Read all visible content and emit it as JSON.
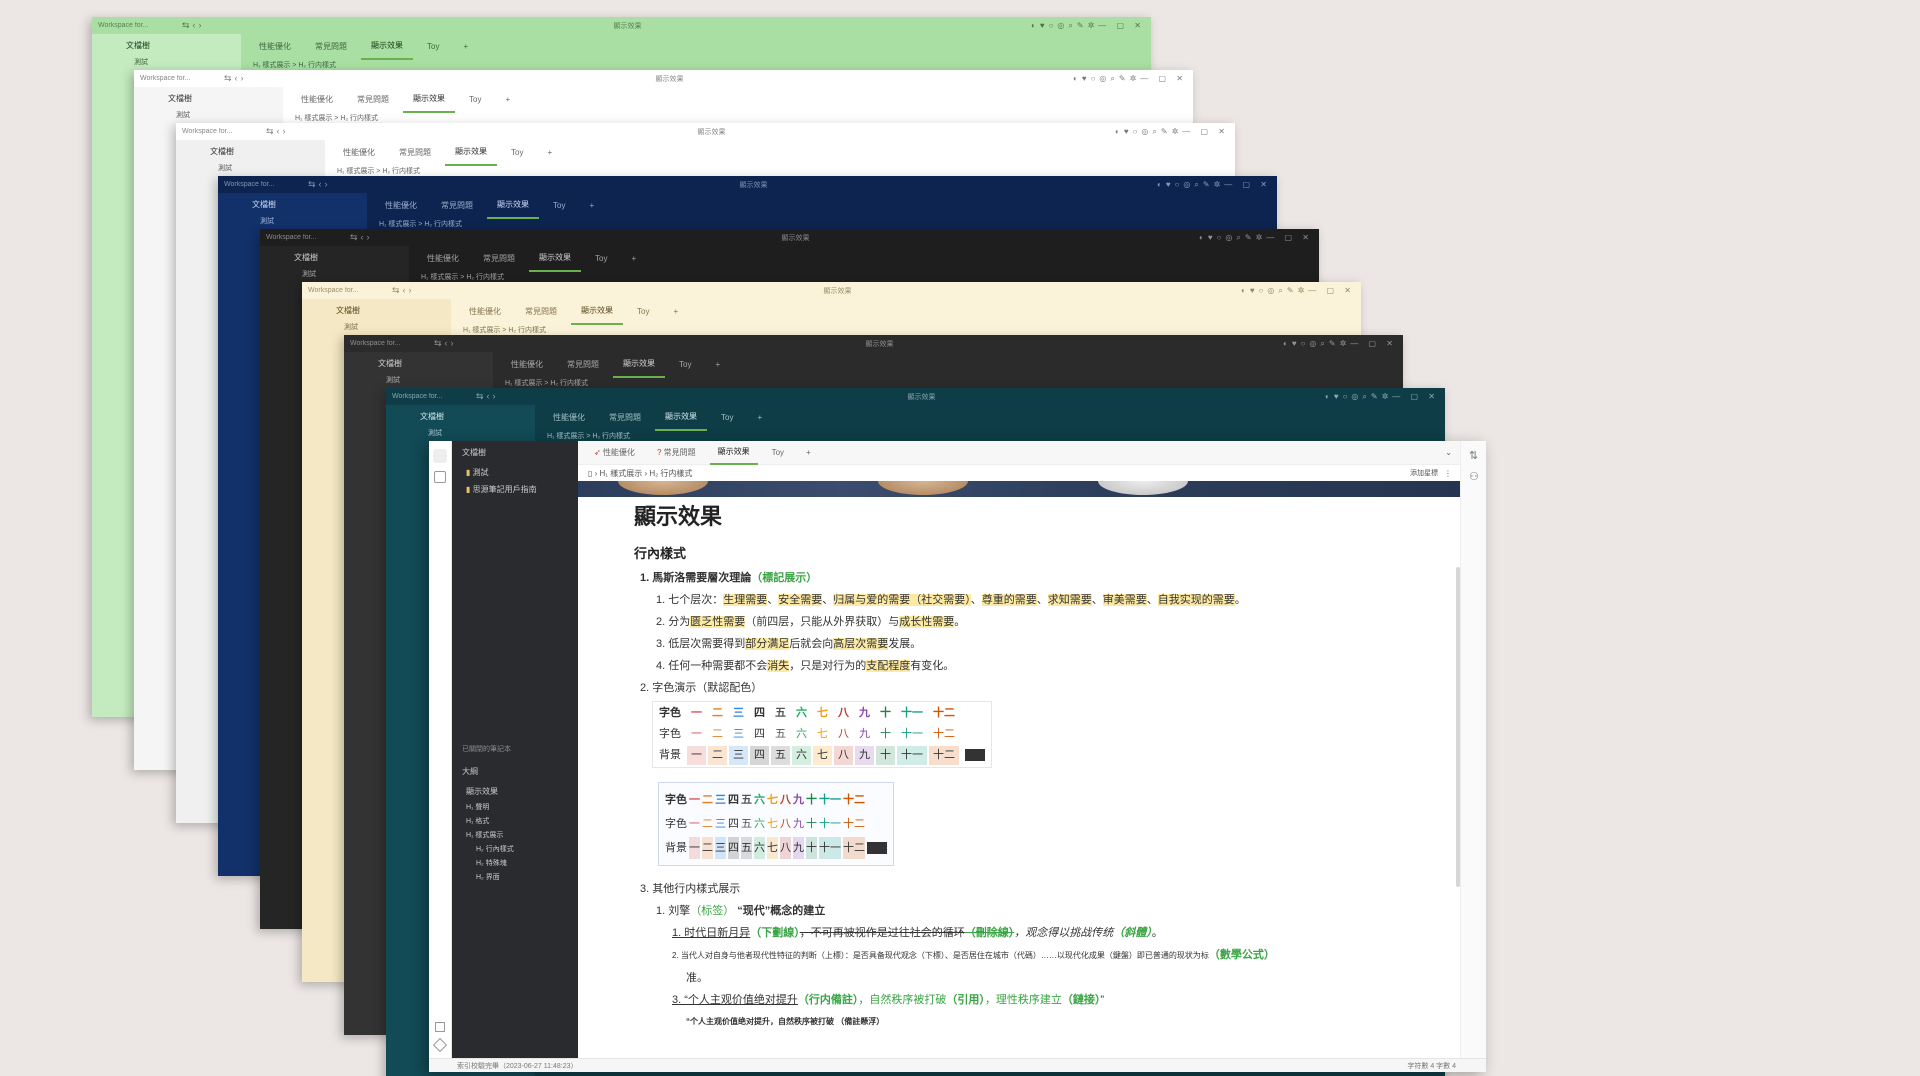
{
  "bg_windows": [
    {
      "ws": "Workspace for...",
      "title": "顯示效果",
      "bg": "#a9dfa3",
      "side": "#c4eabf",
      "fg": "#1b3b1b",
      "sideLabel": "文檔樹",
      "item": "測試",
      "tabs": [
        "性能優化",
        "常見問題",
        "顯示效果",
        "Toy"
      ],
      "crumb": "H₁ 樣式展示 > H₂ 行内樣式"
    },
    {
      "ws": "Workspace for...",
      "title": "顯示效果",
      "bg": "#ffffff",
      "side": "#f5f5f5",
      "fg": "#333",
      "sideLabel": "文檔樹",
      "item": "測試",
      "tabs": [
        "性能優化",
        "常見問題",
        "顯示效果",
        "Toy"
      ],
      "crumb": "H₁ 樣式展示 > H₂ 行内樣式"
    },
    {
      "ws": "Workspace for...",
      "title": "顯示效果",
      "bg": "#ffffff",
      "side": "#f0f0f0",
      "fg": "#333",
      "sideLabel": "文檔樹",
      "item": "測試",
      "tabs": [
        "性能優化",
        "常見問題",
        "顯示效果",
        "Toy"
      ],
      "crumb": "H₁ 樣式展示 > H₂ 行内樣式"
    },
    {
      "ws": "Workspace for...",
      "title": "顯示效果",
      "bg": "#0d2450",
      "side": "#12306a",
      "fg": "#c9d8f5",
      "sideLabel": "文檔樹",
      "item": "測試",
      "tabs": [
        "性能優化",
        "常見問題",
        "顯示效果",
        "Toy"
      ],
      "crumb": "H₁ 樣式展示 > H₂ 行内樣式"
    },
    {
      "ws": "Workspace for...",
      "title": "顯示效果",
      "bg": "#1e1e1e",
      "side": "#252526",
      "fg": "#cccccc",
      "sideLabel": "文檔樹",
      "item": "測試",
      "tabs": [
        "性能優化",
        "常見問題",
        "顯示效果",
        "Toy"
      ],
      "crumb": "H₁ 樣式展示 > H₂ 行内樣式"
    },
    {
      "ws": "Workspace for...",
      "title": "顯示效果",
      "bg": "#fbf3d9",
      "side": "#f4e9c4",
      "fg": "#5a4a1e",
      "sideLabel": "文檔樹",
      "item": "測試",
      "tabs": [
        "性能優化",
        "常見問題",
        "顯示效果",
        "Toy"
      ],
      "crumb": "H₁ 樣式展示 > H₂ 行内樣式"
    },
    {
      "ws": "Workspace for...",
      "title": "顯示效果",
      "bg": "#2b2b2b",
      "side": "#333333",
      "fg": "#cfcfcf",
      "sideLabel": "文檔樹",
      "item": "測試",
      "tabs": [
        "性能優化",
        "常見問題",
        "顯示效果",
        "Toy"
      ],
      "crumb": "H₁ 樣式展示 > H₂ 行内樣式"
    },
    {
      "ws": "Workspace for...",
      "title": "顯示效果",
      "bg": "#0e3d47",
      "side": "#124a55",
      "fg": "#cfe6ea",
      "sideLabel": "文檔樹",
      "item": "測試",
      "tabs": [
        "性能優化",
        "常見問題",
        "顯示效果",
        "Toy"
      ],
      "crumb": "H₁ 樣式展示 > H₂ 行内樣式"
    }
  ],
  "front": {
    "tabs": [
      "性能優化",
      "常見問題",
      "顯示效果",
      "Toy"
    ],
    "tab_add": "+",
    "crumb": [
      "H₁ 樣式展示",
      "H₂ 行内樣式"
    ],
    "crumb_right": "添加星標",
    "sidebar": {
      "title": "文檔樹",
      "items": [
        "測試",
        "思源筆記用戶指南"
      ],
      "recent": "已關閉的筆記本",
      "outline_title": "大綱",
      "outline_doc": "顯示效果",
      "outline": [
        "H₁ 聲明",
        "H₁ 格式",
        "H₁ 樣式展示",
        "H₂ 行內樣式",
        "H₂ 特殊塊",
        "H₂ 界面"
      ]
    },
    "doc": {
      "title": "顯示效果",
      "h2": "行內樣式",
      "l1": "1. 馬斯洛需要層次理論",
      "l1_tag": "（標記展示）",
      "s1_pre": "1. 七个层次：",
      "s1_items": [
        "生理需要",
        "安全需要",
        "归属与爱的需要（社交需要）",
        "尊重的需要",
        "求知需要",
        "审美需要",
        "自我实现的需要"
      ],
      "s2_pre": "2. 分为",
      "s2_a": "匮乏性需要",
      "s2_mid": "（前四层，只能从外界获取）与",
      "s2_b": "成长性需要",
      "s2_end": "。",
      "s3_pre": "3. 低层次需要得到",
      "s3_a": "部分满足",
      "s3_mid": "后就会向",
      "s3_b": "高层次需要",
      "s3_end": "发展。",
      "s4_pre": "4. 任何一种需要都不会",
      "s4_a": "消失",
      "s4_mid": "，只是对行为的",
      "s4_b": "支配程度",
      "s4_end": "有变化。",
      "l2": "2. 字色演示（默認配色）",
      "row_labels": [
        "字色",
        "字色",
        "背景"
      ],
      "nums": [
        "一",
        "二",
        "三",
        "四",
        "五",
        "六",
        "七",
        "八",
        "九",
        "十",
        "十一",
        "十二"
      ],
      "num_colors": [
        "#d9534f",
        "#e67e22",
        "#2e86de",
        "#333333",
        "#555555",
        "#27ae60",
        "#f39c12",
        "#c0392b",
        "#8e44ad",
        "#1e8449",
        "#16a085",
        "#d35400"
      ],
      "l3": "3. 其他行内樣式展示",
      "l3_1a": "1. 刘擎",
      "l3_1tag": "（标签）",
      "l3_1b": "“现代”概念的建立",
      "l3_s1a": "1. 时代日新月异",
      "l3_s1b": "（下劃線）",
      "l3_s1c": "，不可再被视作是过往社会的循环",
      "l3_s1d": "（刪除線）",
      "l3_s1e": "，观念得以挑战传统",
      "l3_s1f": "（斜體）",
      "l3_s1g": "。",
      "l3_s2a": "2. 当代人对自身与他者现代性特征的判断（上標）：是否具备现代观念（下標）、是否居住在城市（代碼）……以现代化成果（鍵盤）即已普通的现状为标",
      "l3_s2b": "（數學公式）",
      "l3_s2c": "准。",
      "l3_s3a": "3. “个人主观价值绝对提升",
      "l3_s3b": "（行内備註）",
      "l3_s3c": "，自然秩序被打破",
      "l3_s3d": "（引用）",
      "l3_s3e": "，理性秩序建立",
      "l3_s3f": "（鏈接）",
      "l3_s3g": "”",
      "l3_last": "“个人主观价值绝对提升，自然秩序被打破 （備註懸浮）"
    },
    "status_left": "索引校驗完畢（2023-06-27 11:48:23）",
    "status_right": "字符數 4  字數 4"
  }
}
